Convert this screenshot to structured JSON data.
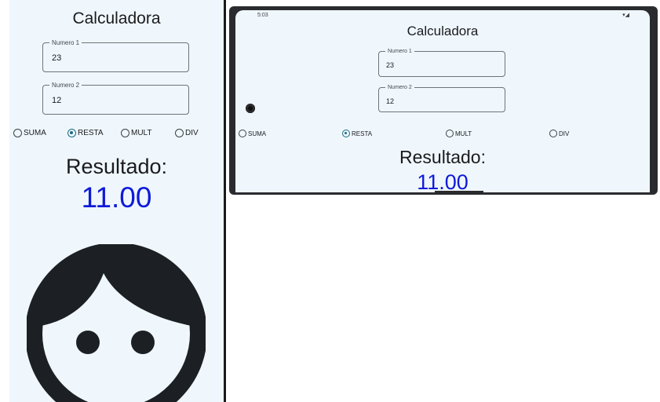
{
  "portrait": {
    "title": "Calculadora",
    "field1": {
      "label": "Numero 1",
      "value": "23"
    },
    "field2": {
      "label": "Numero 2",
      "value": "12"
    },
    "operations": [
      "SUMA",
      "RESTA",
      "MULT",
      "DIV"
    ],
    "selected_operation": "RESTA",
    "result_label": "Resultado:",
    "result_value": "11.00",
    "image": "face-icon"
  },
  "landscape": {
    "status_time": "5:03",
    "title": "Calculadora",
    "field1": {
      "label": "Numero 1",
      "value": "23"
    },
    "field2": {
      "label": "Numero 2",
      "value": "12"
    },
    "operations": [
      "SUMA",
      "RESTA",
      "MULT",
      "DIV"
    ],
    "selected_operation": "RESTA",
    "result_label": "Resultado:",
    "result_value": "11.00"
  },
  "colors": {
    "accent": "#1a6b80",
    "result": "#0f1ad8",
    "background": "#eff7fd"
  }
}
